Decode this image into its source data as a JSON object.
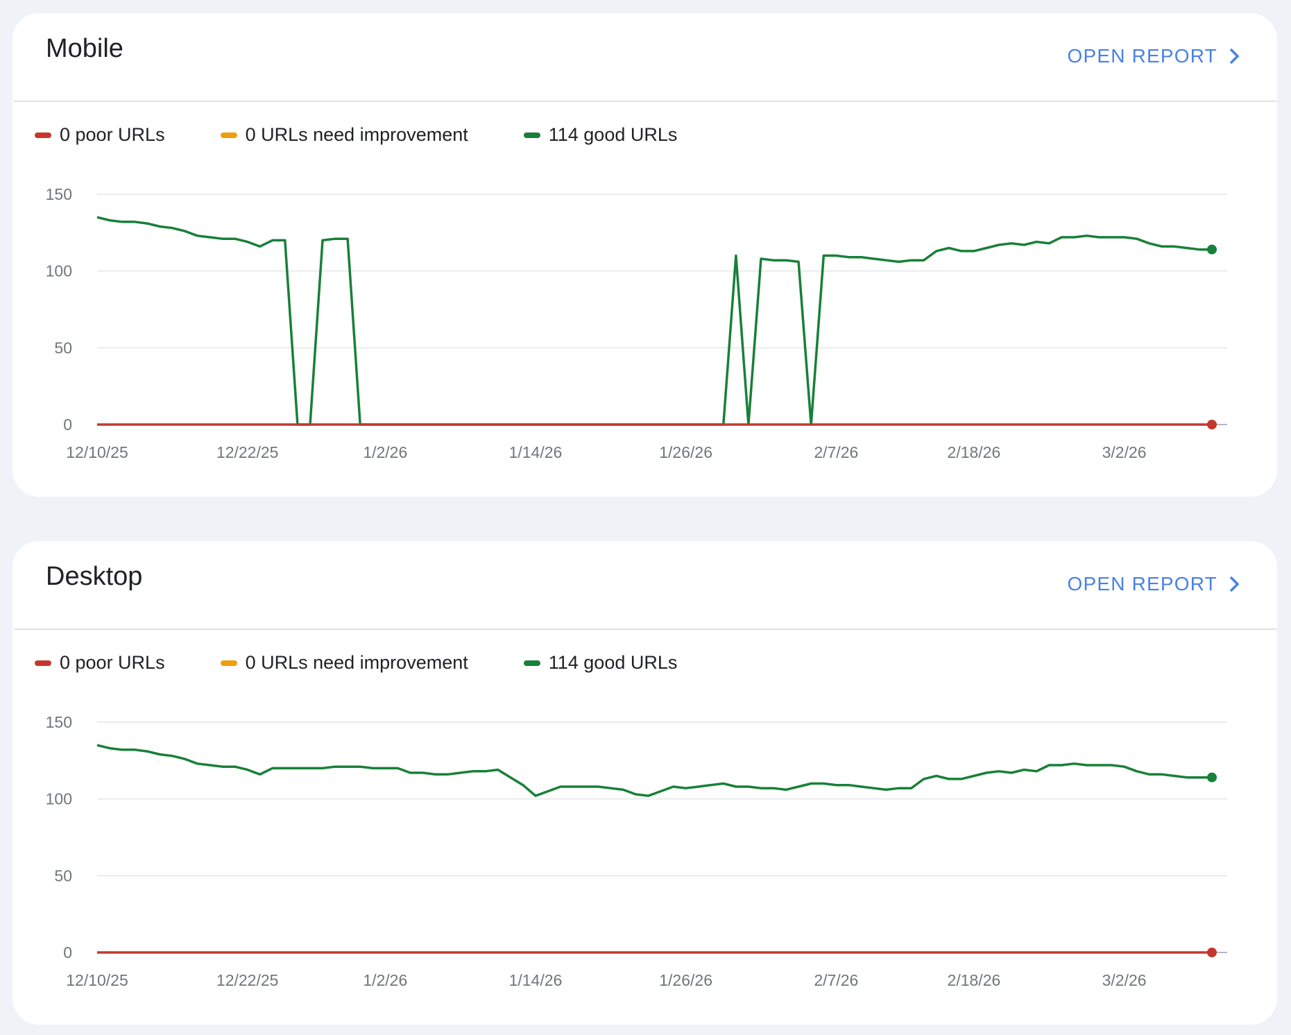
{
  "colors": {
    "poor": "#c5372c",
    "needs_improvement": "#f09d0e",
    "good": "#188038",
    "link": "#4a80e8"
  },
  "panels": [
    {
      "title": "Mobile",
      "open_report_label": "OPEN REPORT",
      "legend": {
        "poor": "0 poor URLs",
        "needs_improvement": "0 URLs need improvement",
        "good": "114 good URLs"
      }
    },
    {
      "title": "Desktop",
      "open_report_label": "OPEN REPORT",
      "legend": {
        "poor": "0 poor URLs",
        "needs_improvement": "0 URLs need improvement",
        "good": "114 good URLs"
      }
    }
  ],
  "chart_data": [
    {
      "type": "line",
      "title": "Mobile",
      "ylim": [
        0,
        150
      ],
      "yticks": [
        0,
        50,
        100,
        150
      ],
      "x_tick_labels": [
        "12/10/25",
        "12/22/25",
        "1/2/26",
        "1/14/26",
        "1/26/26",
        "2/7/26",
        "2/18/26",
        "3/2/26"
      ],
      "x_tick_days": [
        0,
        12,
        23,
        35,
        47,
        59,
        70,
        82
      ],
      "grid": true,
      "series": [
        {
          "name": "0 poor URLs",
          "x_days": [
            0,
            89
          ],
          "values": [
            0,
            0
          ]
        },
        {
          "name": "114 good URLs",
          "x_days": [
            0,
            1,
            2,
            3,
            4,
            5,
            6,
            7,
            8,
            9,
            10,
            11,
            12,
            13,
            14,
            15,
            16,
            17,
            18,
            19,
            20,
            21,
            22,
            23,
            24,
            25,
            26,
            27,
            28,
            29,
            30,
            31,
            32,
            33,
            34,
            35,
            36,
            37,
            38,
            39,
            40,
            41,
            42,
            43,
            44,
            45,
            46,
            47,
            48,
            49,
            50,
            51,
            52,
            53,
            54,
            55,
            56,
            57,
            58,
            59,
            60,
            61,
            62,
            63,
            64,
            65,
            66,
            67,
            68,
            69,
            70,
            71,
            72,
            73,
            74,
            75,
            76,
            77,
            78,
            79,
            80,
            81,
            82,
            83,
            84,
            85,
            86,
            87,
            88,
            89
          ],
          "values": [
            135,
            133,
            132,
            132,
            131,
            129,
            128,
            126,
            123,
            122,
            121,
            121,
            119,
            116,
            120,
            120,
            0,
            0,
            120,
            121,
            121,
            0,
            0,
            0,
            0,
            0,
            0,
            0,
            0,
            0,
            0,
            0,
            0,
            0,
            0,
            0,
            0,
            0,
            0,
            0,
            0,
            0,
            0,
            0,
            0,
            0,
            0,
            0,
            0,
            0,
            0,
            110,
            0,
            108,
            107,
            107,
            106,
            0,
            110,
            110,
            109,
            109,
            108,
            107,
            106,
            107,
            107,
            113,
            115,
            113,
            113,
            115,
            117,
            118,
            117,
            119,
            118,
            122,
            122,
            123,
            122,
            122,
            122,
            121,
            118,
            116,
            116,
            115,
            114,
            114
          ]
        }
      ]
    },
    {
      "type": "line",
      "title": "Desktop",
      "ylim": [
        0,
        150
      ],
      "yticks": [
        0,
        50,
        100,
        150
      ],
      "x_tick_labels": [
        "12/10/25",
        "12/22/25",
        "1/2/26",
        "1/14/26",
        "1/26/26",
        "2/7/26",
        "2/18/26",
        "3/2/26"
      ],
      "x_tick_days": [
        0,
        12,
        23,
        35,
        47,
        59,
        70,
        82
      ],
      "grid": true,
      "series": [
        {
          "name": "0 poor URLs",
          "x_days": [
            0,
            89
          ],
          "values": [
            0,
            0
          ]
        },
        {
          "name": "114 good URLs",
          "x_days": [
            0,
            1,
            2,
            3,
            4,
            5,
            6,
            7,
            8,
            9,
            10,
            11,
            12,
            13,
            14,
            15,
            16,
            17,
            18,
            19,
            20,
            21,
            22,
            23,
            24,
            25,
            26,
            27,
            28,
            29,
            30,
            31,
            32,
            33,
            34,
            35,
            36,
            37,
            38,
            39,
            40,
            41,
            42,
            43,
            44,
            45,
            46,
            47,
            48,
            49,
            50,
            51,
            52,
            53,
            54,
            55,
            56,
            57,
            58,
            59,
            60,
            61,
            62,
            63,
            64,
            65,
            66,
            67,
            68,
            69,
            70,
            71,
            72,
            73,
            74,
            75,
            76,
            77,
            78,
            79,
            80,
            81,
            82,
            83,
            84,
            85,
            86,
            87,
            88,
            89
          ],
          "values": [
            135,
            133,
            132,
            132,
            131,
            129,
            128,
            126,
            123,
            122,
            121,
            121,
            119,
            116,
            120,
            120,
            120,
            120,
            120,
            121,
            121,
            121,
            120,
            120,
            120,
            117,
            117,
            116,
            116,
            117,
            118,
            118,
            119,
            114,
            109,
            102,
            105,
            108,
            108,
            108,
            108,
            107,
            106,
            103,
            102,
            105,
            108,
            107,
            108,
            109,
            110,
            108,
            108,
            107,
            107,
            106,
            108,
            110,
            110,
            109,
            109,
            108,
            107,
            106,
            107,
            107,
            113,
            115,
            113,
            113,
            115,
            117,
            118,
            117,
            119,
            118,
            122,
            122,
            123,
            122,
            122,
            122,
            121,
            118,
            116,
            116,
            115,
            114,
            114,
            114
          ]
        }
      ]
    }
  ]
}
